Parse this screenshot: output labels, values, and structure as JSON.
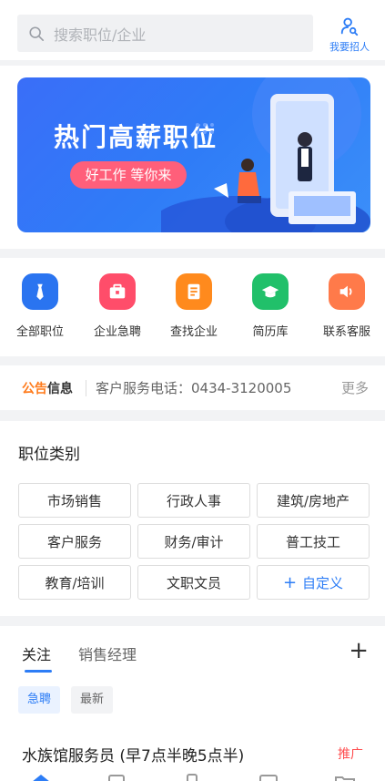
{
  "search": {
    "placeholder": "搜索职位/企业"
  },
  "recruit": {
    "label": "我要招人"
  },
  "banner": {
    "title": "热门高薪职位",
    "pill": "好工作 等你来"
  },
  "quick": [
    {
      "label": "全部职位",
      "color": "#2a74f0",
      "icon": "tie-icon"
    },
    {
      "label": "企业急聘",
      "color": "#ff4d6a",
      "icon": "briefcase-icon"
    },
    {
      "label": "查找企业",
      "color": "#ff8a1d",
      "icon": "building-icon"
    },
    {
      "label": "简历库",
      "color": "#21c06a",
      "icon": "graduation-cap-icon"
    },
    {
      "label": "联系客服",
      "color": "#ff7a4a",
      "icon": "speaker-icon"
    }
  ],
  "notice": {
    "brand_part1": "公告",
    "brand_part2": "信息",
    "text": "客户服务电话：0434-3120005",
    "more": "更多"
  },
  "category": {
    "title": "职位类别",
    "items": [
      "市场销售",
      "行政人事",
      "建筑/房地产",
      "客户服务",
      "财务/审计",
      "普工技工",
      "教育/培训",
      "文职文员"
    ],
    "custom": "自定义"
  },
  "tabs": {
    "active": "关注",
    "inactive": "销售经理",
    "add": "+"
  },
  "filters": {
    "urgent": "急聘",
    "latest": "最新"
  },
  "job": {
    "title": "水族馆服务员 (早7点半晚5点半)",
    "tag": "推广"
  },
  "colors": {
    "accent": "#2d7df6",
    "tag_red": "#ff4d4f",
    "notice_orange": "#ff7a1a"
  }
}
